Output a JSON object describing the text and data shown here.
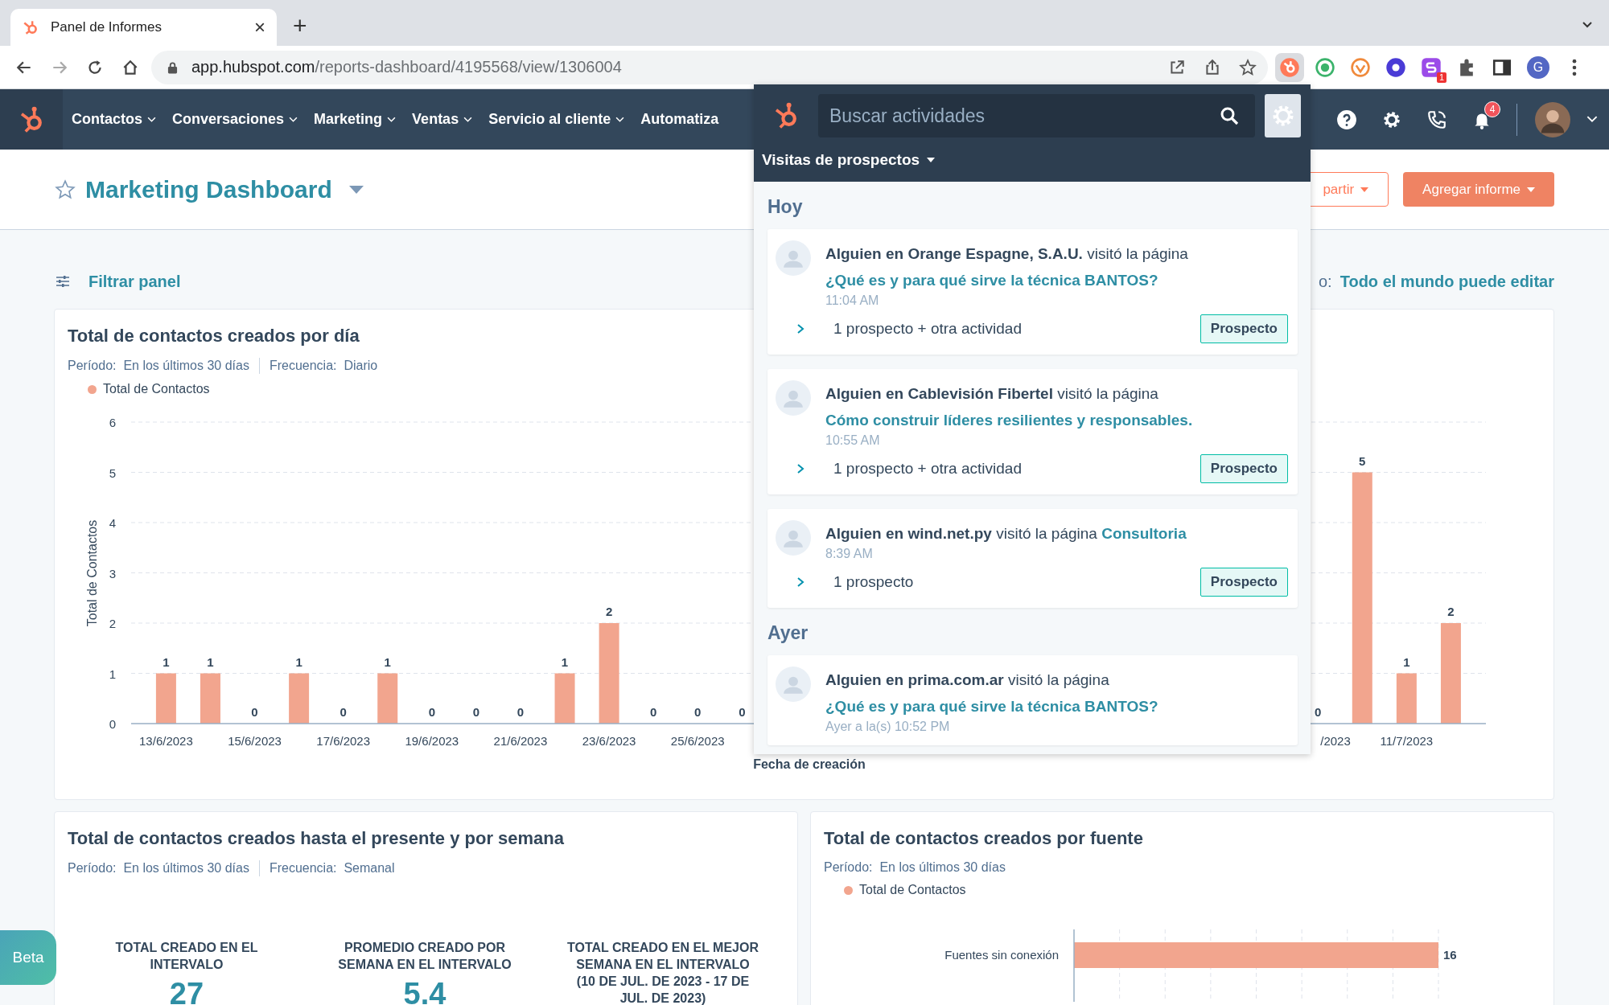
{
  "browser": {
    "tab": {
      "title": "Panel de Informes",
      "close": "×"
    },
    "new_tab": "+",
    "url_host": "app.hubspot.com",
    "url_path": "/reports-dashboard/4195568/view/1306004",
    "extension_badge": "1",
    "profile_initial": "G"
  },
  "nav": {
    "items": [
      {
        "label": "Contactos",
        "caret": true
      },
      {
        "label": "Conversaciones",
        "caret": true
      },
      {
        "label": "Marketing",
        "caret": true
      },
      {
        "label": "Ventas",
        "caret": true
      },
      {
        "label": "Servicio al cliente",
        "caret": true
      },
      {
        "label": "Automatiza",
        "caret": false
      }
    ],
    "notifications": "4"
  },
  "dashboard": {
    "title": "Marketing Dashboard",
    "share_button": "partir",
    "add_button": "Agregar informe",
    "filter": "Filtrar panel",
    "access_label": "o:",
    "access_value": "Todo el mundo puede editar"
  },
  "daily_chart": {
    "title": "Total de contactos creados por día",
    "meta": [
      {
        "label": "Período:",
        "value": "En los últimos 30 días"
      },
      {
        "label": "Frecuencia:",
        "value": "Diario"
      }
    ],
    "chart_data": {
      "type": "bar",
      "xlabel": "Fecha de creación",
      "ylabel": "Total de Contactos",
      "categories": [
        "13/6/2023",
        null,
        "15/6/2023",
        null,
        "17/6/2023",
        null,
        "19/6/2023",
        null,
        "21/6/2023",
        null,
        "23/6/2023",
        null,
        "25/6/2023",
        null,
        null,
        null,
        null,
        null,
        null,
        null,
        null,
        null,
        null,
        null,
        null,
        null,
        "/2023",
        null,
        "11/7/2023",
        null
      ],
      "series": [
        {
          "name": "Total de Contactos",
          "color": "#f2a58e",
          "values": [
            1,
            1,
            0,
            1,
            0,
            1,
            0,
            0,
            0,
            1,
            2,
            0,
            0,
            0,
            null,
            null,
            null,
            null,
            null,
            null,
            null,
            null,
            null,
            null,
            null,
            null,
            0,
            5,
            1,
            2
          ]
        }
      ],
      "value_labels": [
        "1",
        "1",
        "0",
        "1",
        "0",
        "1",
        "0",
        "0",
        "0",
        "1",
        "2",
        "0",
        "0",
        "0",
        null,
        null,
        null,
        null,
        null,
        null,
        null,
        null,
        null,
        null,
        null,
        null,
        "0",
        "5",
        "1",
        "2"
      ],
      "ylim": [
        0,
        6
      ],
      "yticks": [
        0,
        1,
        2,
        3,
        4,
        5,
        6
      ],
      "grid": true
    }
  },
  "weekly_card": {
    "title": "Total de contactos creados hasta el presente y por semana",
    "meta": [
      {
        "label": "Período:",
        "value": "En los últimos 30 días"
      },
      {
        "label": "Frecuencia:",
        "value": "Semanal"
      }
    ],
    "stats": [
      {
        "label": "TOTAL CREADO EN EL INTERVALO",
        "value": "27"
      },
      {
        "label": "PROMEDIO CREADO POR SEMANA EN EL INTERVALO",
        "value": "5.4"
      },
      {
        "label": "TOTAL CREADO EN EL MEJOR SEMANA EN EL INTERVALO (10 DE JUL. DE 2023 - 17 DE JUL. DE 2023)"
      }
    ]
  },
  "source_card": {
    "title": "Total de contactos creados por fuente",
    "meta": [
      {
        "label": "Período:",
        "value": "En los últimos 30 días"
      }
    ],
    "chart_data": {
      "type": "bar",
      "orientation": "horizontal",
      "categories": [
        "Fuentes sin conexión"
      ],
      "series": [
        {
          "name": "Total de Contactos",
          "color": "#f2a58e",
          "values": [
            16
          ]
        }
      ],
      "value_labels": [
        "16"
      ],
      "data_labels": true,
      "grid": true
    }
  },
  "beta_button": "Beta",
  "activity_panel": {
    "search": {
      "placeholder": "Buscar actividades"
    },
    "filter": "Visitas de prospectos",
    "groups": [
      {
        "label": "Hoy",
        "visits": [
          {
            "actor": "Alguien en Orange Espagne, S.A.U.",
            "verb": "visitó la página",
            "page": "¿Qué es y para qué sirve la técnica BANTOS?",
            "time": "11:04 AM",
            "summary": "1 prospecto + otra actividad",
            "tag": "Prospecto"
          },
          {
            "actor": "Alguien en Cablevisión Fibertel",
            "verb": "visitó la página",
            "page": "Cómo construir líderes resilientes y responsables.",
            "time": "10:55 AM",
            "summary": "1 prospecto + otra actividad",
            "tag": "Prospecto"
          },
          {
            "actor": "Alguien en wind.net.py",
            "verb": "visitó la página",
            "page": "Consultoria",
            "time": "8:39 AM",
            "summary": "1 prospecto",
            "tag": "Prospecto"
          }
        ]
      },
      {
        "label": "Ayer",
        "visits": [
          {
            "actor": "Alguien en prima.com.ar",
            "verb": "visitó la página",
            "page": "¿Qué es y para qué sirve la técnica BANTOS?",
            "time": "Ayer a la(s) 10:52 PM"
          }
        ]
      }
    ]
  }
}
